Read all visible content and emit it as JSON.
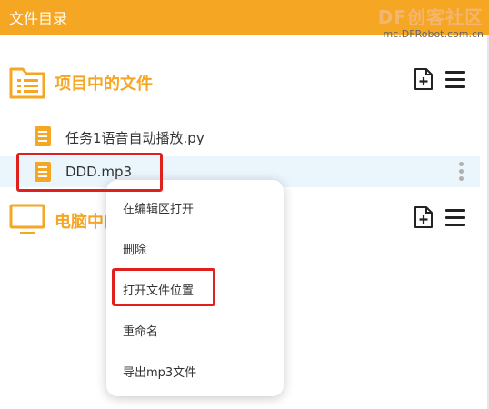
{
  "header": {
    "title": "文件目录",
    "watermark_brand": "DF创客社区",
    "watermark_url": "mc.DFRobot.com.cn"
  },
  "sections": [
    {
      "title": "项目中的文件",
      "icon": "folder-list-icon"
    },
    {
      "title": "电脑中的文件",
      "icon": "monitor-icon"
    }
  ],
  "files": [
    {
      "name": "任务1语音自动播放.py",
      "icon": "document-icon",
      "selected": false
    },
    {
      "name": "DDD.mp3",
      "icon": "document-icon",
      "selected": true
    }
  ],
  "context_menu": {
    "items": [
      "在编辑区打开",
      "删除",
      "打开文件位置",
      "重命名",
      "导出mp3文件"
    ]
  },
  "colors": {
    "accent": "#f5a623",
    "highlight_box": "#e0201c",
    "selected_row": "#eaf5fc"
  }
}
